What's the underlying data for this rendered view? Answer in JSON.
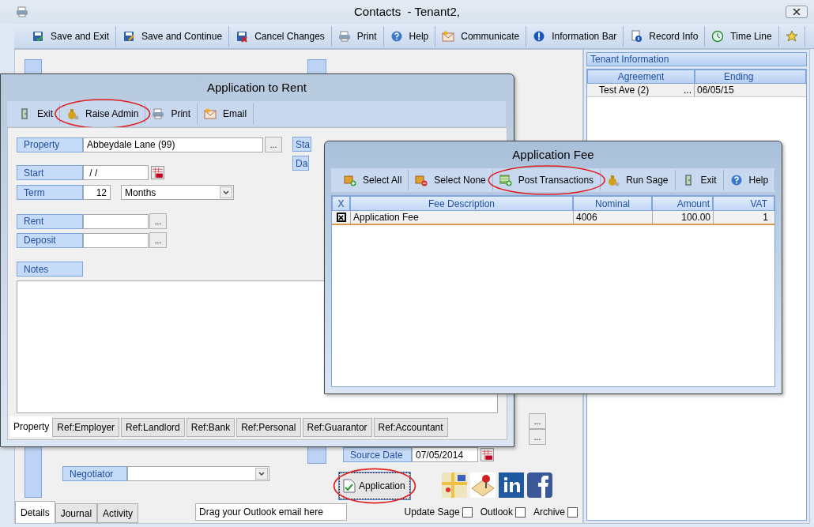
{
  "window": {
    "title": "Contacts  - Tenant2,"
  },
  "toolbar": [
    {
      "label": "Save and Exit",
      "kind": "save"
    },
    {
      "label": "Save and Continue",
      "kind": "save-edit"
    },
    {
      "label": "Cancel Changes",
      "kind": "cancel"
    },
    {
      "label": "Print",
      "kind": "print"
    },
    {
      "label": "Help",
      "kind": "help"
    },
    {
      "label": "Communicate",
      "kind": "mail"
    },
    {
      "label": "Information Bar",
      "kind": "info"
    },
    {
      "label": "Record Info",
      "kind": "record"
    },
    {
      "label": "Time Line",
      "kind": "clock"
    },
    {
      "kind": "star"
    }
  ],
  "tenant_info": {
    "title": "Tenant Information",
    "columns": [
      "Agreement",
      "Ending"
    ],
    "rows": [
      {
        "agreement": "Test Ave (2)",
        "more": "...",
        "ending": "06/05/15"
      }
    ]
  },
  "main_form": {
    "negotiator_label": "Negotiator",
    "source_date_label": "Source Date",
    "source_date": "07/05/2014",
    "ellipsis_buttons": [
      "...",
      "..."
    ],
    "application_button": {
      "label": "Application",
      "circled": true
    }
  },
  "bottom_tabs": [
    {
      "label": "Details",
      "selected": true
    },
    {
      "label": "Journal",
      "selected": false
    },
    {
      "label": "Activity",
      "selected": false
    }
  ],
  "outlook_drop": "Drag your Outlook email here",
  "checkboxes": [
    {
      "label": "Update Sage",
      "checked": false
    },
    {
      "label": "Outlook",
      "checked": false
    },
    {
      "label": "Archive",
      "checked": false
    }
  ],
  "rent_dialog": {
    "title": "Application to Rent",
    "toolbar": [
      {
        "label": "Exit",
        "kind": "door",
        "circled": false
      },
      {
        "label": "Raise Admin",
        "kind": "money",
        "circled": true
      },
      {
        "label": "Print",
        "kind": "print",
        "circled": false
      },
      {
        "label": "Email",
        "kind": "mail",
        "circled": false
      }
    ],
    "property_label": "Property",
    "property": "Abbeydale Lane (99)",
    "property_button": "...",
    "start_label": "Start",
    "start": " / /",
    "term_label": "Term",
    "term": "12",
    "term_unit": "Months",
    "rent_label": "Rent",
    "rent_button": "...",
    "deposit_label": "Deposit",
    "deposit_button": "...",
    "notes_label": "Notes",
    "status_label": "Sta",
    "date_label": "Da",
    "tabs": [
      {
        "label": "Property",
        "selected": true
      },
      {
        "label": "Ref:Employer",
        "selected": false
      },
      {
        "label": "Ref:Landlord",
        "selected": false
      },
      {
        "label": "Ref:Bank",
        "selected": false
      },
      {
        "label": "Ref:Personal",
        "selected": false
      },
      {
        "label": "Ref:Guarantor",
        "selected": false
      },
      {
        "label": "Ref:Accountant",
        "selected": false
      }
    ]
  },
  "fee_dialog": {
    "title": "Application Fee",
    "toolbar": [
      {
        "label": "Select All",
        "kind": "box-add",
        "circled": false
      },
      {
        "label": "Select None",
        "kind": "box-remove",
        "circled": false
      },
      {
        "label": "Post Transactions",
        "kind": "post",
        "circled": true
      },
      {
        "label": "Run Sage",
        "kind": "money",
        "circled": false
      },
      {
        "label": "Exit",
        "kind": "door",
        "circled": false
      },
      {
        "label": "Help",
        "kind": "help",
        "circled": false
      }
    ],
    "columns": [
      "X",
      "Fee Description",
      "Nominal",
      "Amount",
      "VAT"
    ],
    "rows": [
      {
        "checked": true,
        "selected": true,
        "description": "Application Fee",
        "nominal": "4006",
        "amount": "100.00",
        "vat": "1"
      }
    ]
  }
}
